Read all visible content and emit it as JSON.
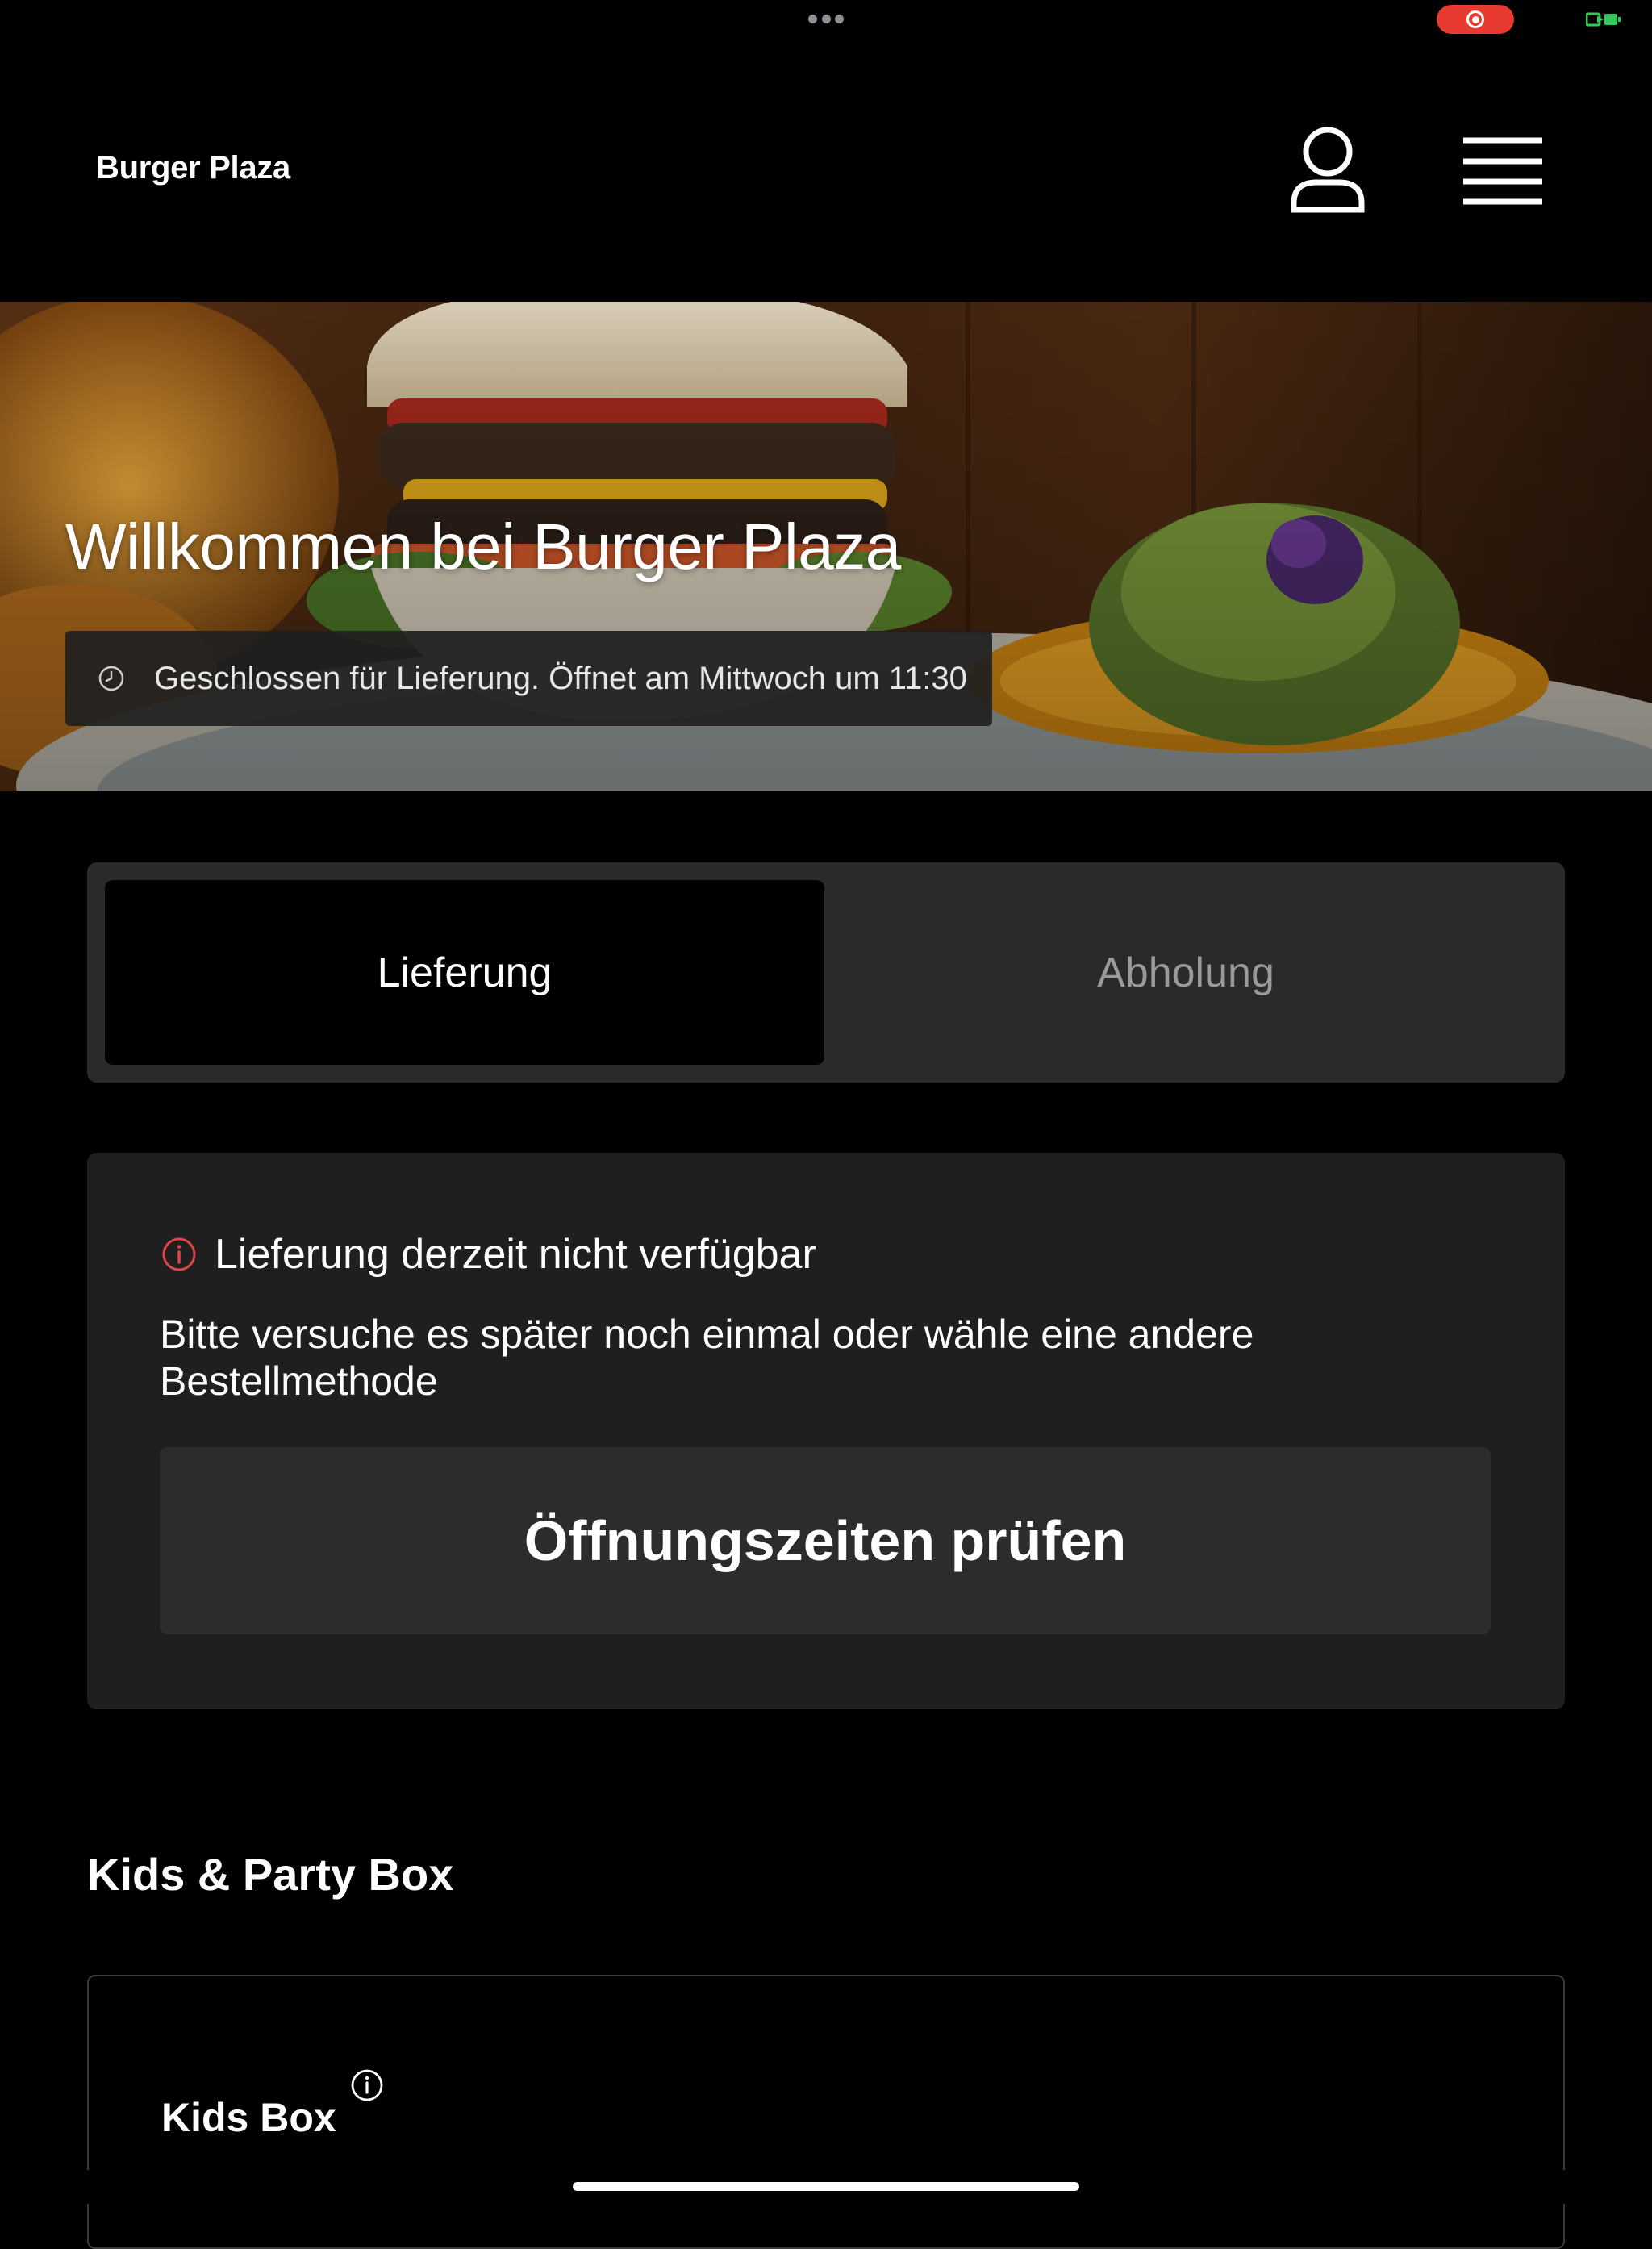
{
  "status_bar": {
    "colors": {
      "recording": "#e83a30",
      "battery": "#34c759"
    }
  },
  "header": {
    "title": "Burger Plaza",
    "profile_icon": "person-icon",
    "menu_icon": "hamburger-menu-icon"
  },
  "hero": {
    "title": "Willkommen bei Burger Plaza",
    "hours_status": "Geschlossen für Lieferung. Öffnet am Mittwoch um 11:30",
    "hours_icon": "clock-icon"
  },
  "order_method": {
    "options": [
      {
        "label": "Lieferung",
        "selected": true
      },
      {
        "label": "Abholung",
        "selected": false
      }
    ]
  },
  "notice": {
    "icon": "info-icon",
    "icon_color": "#e0454c",
    "heading": "Lieferung derzeit nicht verfügbar",
    "body": "Bitte versuche es später noch einmal oder wähle eine andere Bestellmethode",
    "button_label": "Öffnungszeiten prüfen"
  },
  "menu": {
    "categories": [
      {
        "title": "Kids & Party Box",
        "items": [
          {
            "name": "Kids Box",
            "info_icon": "info-icon"
          }
        ]
      }
    ]
  }
}
